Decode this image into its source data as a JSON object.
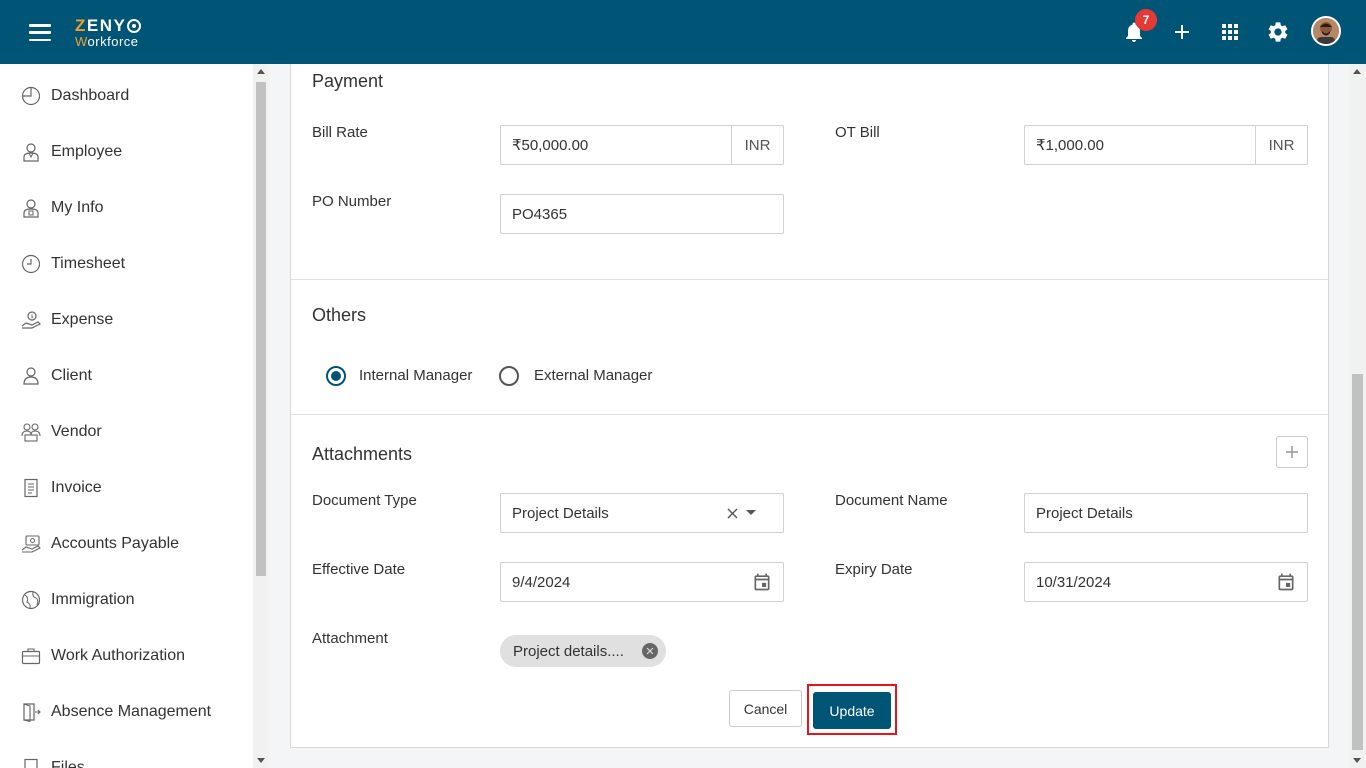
{
  "header": {
    "logo_top": "ZENY",
    "logo_bottom_initial": "W",
    "logo_bottom_rest": "orkforce",
    "notification_count": "7",
    "icons": [
      "menu-icon",
      "bell-icon",
      "plus-icon",
      "apps-grid-icon",
      "gear-icon",
      "avatar"
    ]
  },
  "sidebar": {
    "items": [
      {
        "label": "Dashboard",
        "icon": "dashboard-icon"
      },
      {
        "label": "Employee",
        "icon": "employee-icon"
      },
      {
        "label": "My Info",
        "icon": "my-info-icon"
      },
      {
        "label": "Timesheet",
        "icon": "clock-icon"
      },
      {
        "label": "Expense",
        "icon": "expense-icon"
      },
      {
        "label": "Client",
        "icon": "person-icon"
      },
      {
        "label": "Vendor",
        "icon": "vendor-icon"
      },
      {
        "label": "Invoice",
        "icon": "invoice-icon"
      },
      {
        "label": "Accounts Payable",
        "icon": "accounts-payable-icon"
      },
      {
        "label": "Immigration",
        "icon": "globe-icon"
      },
      {
        "label": "Work Authorization",
        "icon": "briefcase-icon"
      },
      {
        "label": "Absence Management",
        "icon": "door-exit-icon"
      },
      {
        "label": "Files",
        "icon": "file-icon"
      }
    ]
  },
  "payment": {
    "title": "Payment",
    "bill_rate_label": "Bill Rate",
    "bill_rate_value": "₹50,000.00",
    "bill_rate_currency": "INR",
    "ot_bill_label": "OT Bill",
    "ot_bill_value": "₹1,000.00",
    "ot_bill_currency": "INR",
    "po_number_label": "PO Number",
    "po_number_value": "PO4365"
  },
  "others": {
    "title": "Others",
    "options": [
      {
        "label": "Internal Manager",
        "checked": true
      },
      {
        "label": "External Manager",
        "checked": false
      }
    ]
  },
  "attachments": {
    "title": "Attachments",
    "document_type_label": "Document Type",
    "document_type_value": "Project Details",
    "document_name_label": "Document Name",
    "document_name_value": "Project Details",
    "effective_date_label": "Effective Date",
    "effective_date_value": "9/4/2024",
    "expiry_date_label": "Expiry Date",
    "expiry_date_value": "10/31/2024",
    "attachment_label": "Attachment",
    "attachment_file": "Project details...."
  },
  "actions": {
    "cancel_label": "Cancel",
    "update_label": "Update"
  },
  "colors": {
    "primary": "#005476",
    "accent": "#f0a02a",
    "badge": "#e53935",
    "highlight": "#e8131b"
  }
}
